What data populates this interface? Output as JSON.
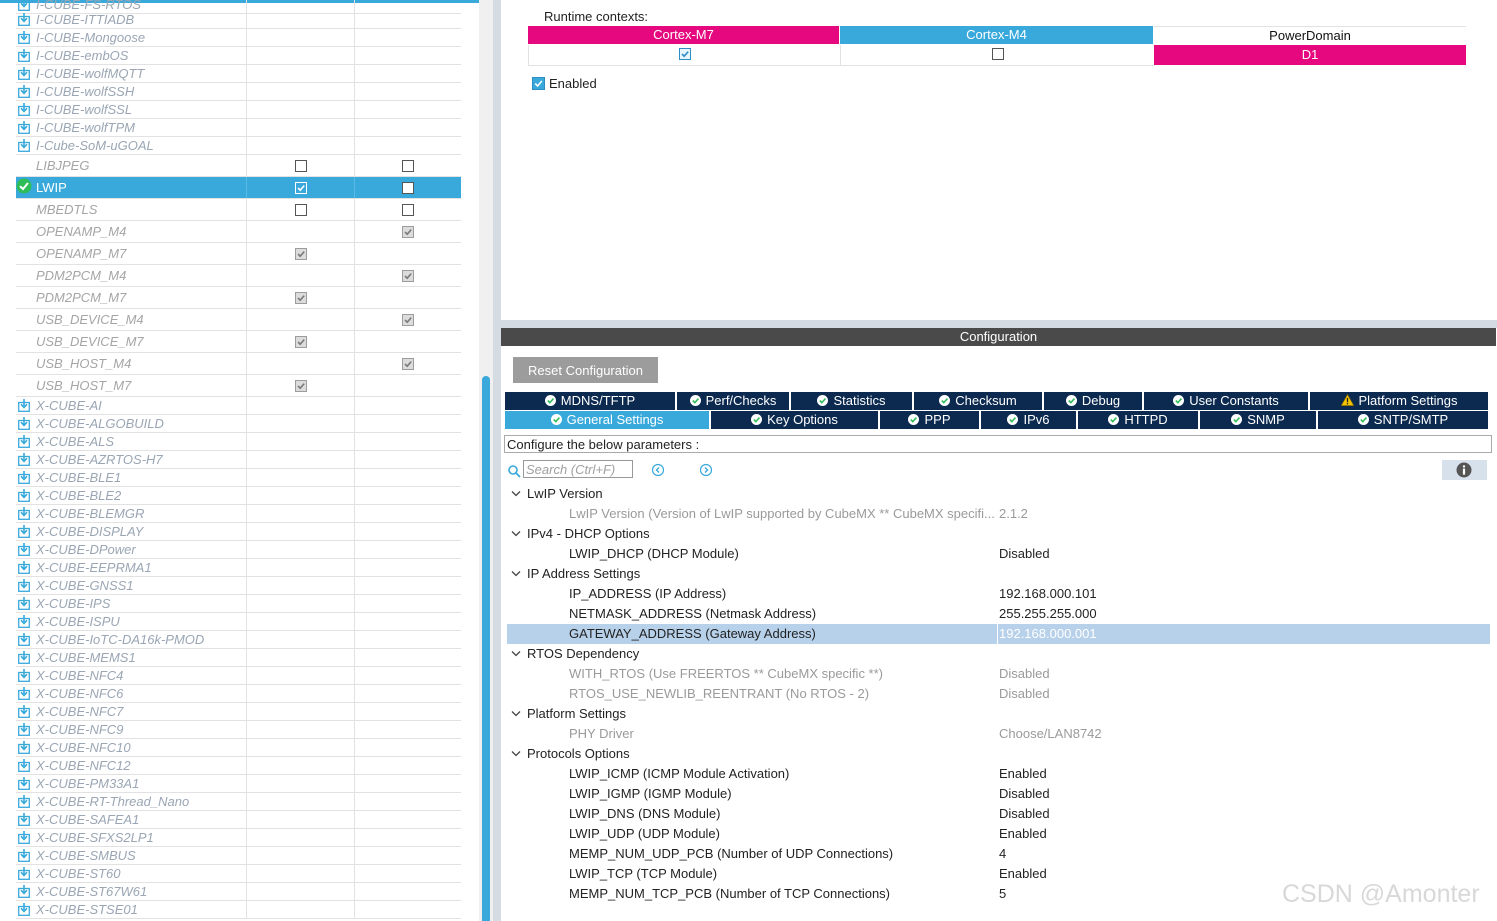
{
  "left_panel": {
    "rows": [
      {
        "name": "I-CUBE-FS-RTOS",
        "type": "bundle"
      },
      {
        "name": "I-CUBE-ITTIADB",
        "type": "bundle"
      },
      {
        "name": "I-CUBE-Mongoose",
        "type": "bundle"
      },
      {
        "name": "I-CUBE-embOS",
        "type": "bundle"
      },
      {
        "name": "I-CUBE-wolfMQTT",
        "type": "bundle"
      },
      {
        "name": "I-CUBE-wolfSSH",
        "type": "bundle"
      },
      {
        "name": "I-CUBE-wolfSSL",
        "type": "bundle"
      },
      {
        "name": "I-CUBE-wolfTPM",
        "type": "bundle"
      },
      {
        "name": "I-Cube-SoM-uGOAL",
        "type": "bundle"
      },
      {
        "name": "LIBJPEG",
        "type": "mw",
        "m7": "empty",
        "m4": "empty"
      },
      {
        "name": "LWIP",
        "type": "selected",
        "m7": "checked-blue",
        "m4": "empty"
      },
      {
        "name": "MBEDTLS",
        "type": "mw",
        "m7": "empty",
        "m4": "empty"
      },
      {
        "name": "OPENAMP_M4",
        "type": "mw",
        "m7": "none",
        "m4": "checked-grey"
      },
      {
        "name": "OPENAMP_M7",
        "type": "mw",
        "m7": "checked-grey",
        "m4": "none"
      },
      {
        "name": "PDM2PCM_M4",
        "type": "mw",
        "m7": "none",
        "m4": "checked-grey"
      },
      {
        "name": "PDM2PCM_M7",
        "type": "mw",
        "m7": "checked-grey",
        "m4": "none"
      },
      {
        "name": "USB_DEVICE_M4",
        "type": "mw",
        "m7": "none",
        "m4": "checked-grey"
      },
      {
        "name": "USB_DEVICE_M7",
        "type": "mw",
        "m7": "checked-grey",
        "m4": "none"
      },
      {
        "name": "USB_HOST_M4",
        "type": "mw",
        "m7": "none",
        "m4": "checked-grey"
      },
      {
        "name": "USB_HOST_M7",
        "type": "mw",
        "m7": "checked-grey",
        "m4": "none"
      },
      {
        "name": "X-CUBE-AI",
        "type": "bundle"
      },
      {
        "name": "X-CUBE-ALGOBUILD",
        "type": "bundle"
      },
      {
        "name": "X-CUBE-ALS",
        "type": "bundle"
      },
      {
        "name": "X-CUBE-AZRTOS-H7",
        "type": "bundle"
      },
      {
        "name": "X-CUBE-BLE1",
        "type": "bundle"
      },
      {
        "name": "X-CUBE-BLE2",
        "type": "bundle"
      },
      {
        "name": "X-CUBE-BLEMGR",
        "type": "bundle"
      },
      {
        "name": "X-CUBE-DISPLAY",
        "type": "bundle"
      },
      {
        "name": "X-CUBE-DPower",
        "type": "bundle"
      },
      {
        "name": "X-CUBE-EEPRMA1",
        "type": "bundle"
      },
      {
        "name": "X-CUBE-GNSS1",
        "type": "bundle"
      },
      {
        "name": "X-CUBE-IPS",
        "type": "bundle"
      },
      {
        "name": "X-CUBE-ISPU",
        "type": "bundle"
      },
      {
        "name": "X-CUBE-IoTC-DA16k-PMOD",
        "type": "bundle"
      },
      {
        "name": "X-CUBE-MEMS1",
        "type": "bundle"
      },
      {
        "name": "X-CUBE-NFC4",
        "type": "bundle"
      },
      {
        "name": "X-CUBE-NFC6",
        "type": "bundle"
      },
      {
        "name": "X-CUBE-NFC7",
        "type": "bundle"
      },
      {
        "name": "X-CUBE-NFC9",
        "type": "bundle"
      },
      {
        "name": "X-CUBE-NFC10",
        "type": "bundle"
      },
      {
        "name": "X-CUBE-NFC12",
        "type": "bundle"
      },
      {
        "name": "X-CUBE-PM33A1",
        "type": "bundle"
      },
      {
        "name": "X-CUBE-RT-Thread_Nano",
        "type": "bundle"
      },
      {
        "name": "X-CUBE-SAFEA1",
        "type": "bundle"
      },
      {
        "name": "X-CUBE-SFXS2LP1",
        "type": "bundle"
      },
      {
        "name": "X-CUBE-SMBUS",
        "type": "bundle"
      },
      {
        "name": "X-CUBE-ST60",
        "type": "bundle"
      },
      {
        "name": "X-CUBE-ST67W61",
        "type": "bundle"
      },
      {
        "name": "X-CUBE-STSE01",
        "type": "bundle"
      }
    ]
  },
  "runtime": {
    "label": "Runtime contexts:",
    "headers": [
      "Cortex-M7",
      "Cortex-M4",
      "PowerDomain"
    ],
    "power_domain_value": "D1",
    "enabled_label": "Enabled"
  },
  "config": {
    "title": "Configuration",
    "reset_label": "Reset Configuration",
    "tabs_row1": [
      "MDNS/TFTP",
      "Perf/Checks",
      "Statistics",
      "Checksum",
      "Debug",
      "User Constants",
      "Platform Settings"
    ],
    "tabs_row2": [
      "General Settings",
      "Key Options",
      "PPP",
      "IPv6",
      "HTTPD",
      "SNMP",
      "SNTP/SMTP"
    ],
    "description": "Configure the below parameters :",
    "search_placeholder": "Search (Ctrl+F)",
    "params": [
      {
        "group": "LwIP Version"
      },
      {
        "name": "LwIP Version (Version of LwIP supported by CubeMX ** CubeMX specifi...",
        "value": "2.1.2",
        "disabled": true
      },
      {
        "group": "IPv4 - DHCP Options"
      },
      {
        "name": "LWIP_DHCP (DHCP Module)",
        "value": "Disabled"
      },
      {
        "group": "IP Address Settings"
      },
      {
        "name": "IP_ADDRESS (IP Address)",
        "value": "192.168.000.101"
      },
      {
        "name": "NETMASK_ADDRESS (Netmask Address)",
        "value": "255.255.255.000"
      },
      {
        "name": "GATEWAY_ADDRESS (Gateway Address)",
        "value": "192.168.000.001",
        "selected": true
      },
      {
        "group": "RTOS Dependency"
      },
      {
        "name": "WITH_RTOS (Use FREERTOS ** CubeMX specific **)",
        "value": "Disabled",
        "disabled": true
      },
      {
        "name": "RTOS_USE_NEWLIB_REENTRANT (No RTOS - 2)",
        "value": "Disabled",
        "disabled": true
      },
      {
        "group": "Platform Settings"
      },
      {
        "name": "PHY Driver",
        "value": "Choose/LAN8742",
        "disabled": true
      },
      {
        "group": "Protocols Options"
      },
      {
        "name": "LWIP_ICMP (ICMP Module Activation)",
        "value": "Enabled"
      },
      {
        "name": "LWIP_IGMP (IGMP Module)",
        "value": "Disabled"
      },
      {
        "name": "LWIP_DNS (DNS Module)",
        "value": "Disabled"
      },
      {
        "name": "LWIP_UDP (UDP Module)",
        "value": "Enabled"
      },
      {
        "name": "MEMP_NUM_UDP_PCB (Number of UDP Connections)",
        "value": "4"
      },
      {
        "name": "LWIP_TCP (TCP Module)",
        "value": "Enabled"
      },
      {
        "name": "MEMP_NUM_TCP_PCB (Number of TCP Connections)",
        "value": "5"
      }
    ]
  },
  "watermark": "CSDN @Amonter",
  "colors": {
    "accent": "#39a9dc",
    "tab_dark": "#0c2a50",
    "m7_pink": "#e5087e",
    "selected_row": "#b8d1ea"
  }
}
